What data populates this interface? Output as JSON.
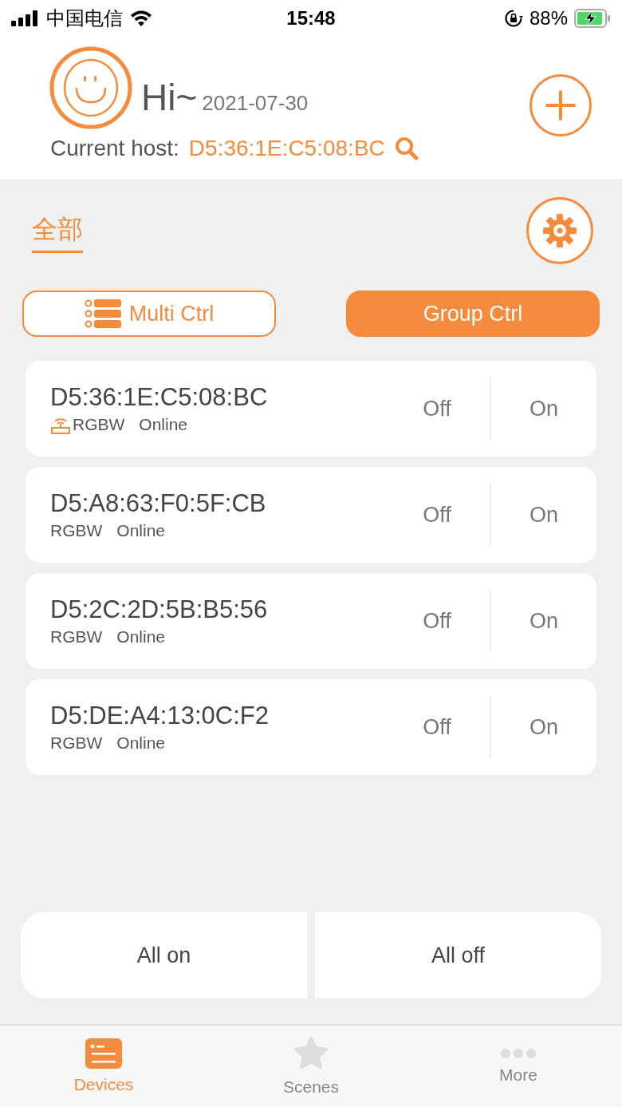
{
  "status_bar": {
    "carrier": "中国电信",
    "time": "15:48",
    "battery": "88%"
  },
  "header": {
    "greeting": "Hi~",
    "date": "2021-07-30",
    "host_label": "Current host:",
    "host_value": "D5:36:1E:C5:08:BC"
  },
  "group_tab": {
    "label": "全部",
    "selected": true
  },
  "modes": [
    {
      "label": "Multi Ctrl",
      "selected": false
    },
    {
      "label": "Group Ctrl",
      "selected": true
    }
  ],
  "devices": [
    {
      "name": "D5:36:1E:C5:08:BC",
      "type": "RGBW",
      "status": "Online",
      "host": true,
      "off": "Off",
      "on": "On"
    },
    {
      "name": "D5:A8:63:F0:5F:CB",
      "type": "RGBW",
      "status": "Online",
      "host": false,
      "off": "Off",
      "on": "On"
    },
    {
      "name": "D5:2C:2D:5B:B5:56",
      "type": "RGBW",
      "status": "Online",
      "host": false,
      "off": "Off",
      "on": "On"
    },
    {
      "name": "D5:DE:A4:13:0C:F2",
      "type": "RGBW",
      "status": "Online",
      "host": false,
      "off": "Off",
      "on": "On"
    }
  ],
  "bulk_buttons": [
    "All on",
    "All off"
  ],
  "tab_bar": [
    {
      "label": "Devices",
      "kind": "devices",
      "selected": true
    },
    {
      "label": "Scenes",
      "kind": "scenes",
      "selected": false
    },
    {
      "label": "More",
      "kind": "more",
      "selected": false
    }
  ]
}
